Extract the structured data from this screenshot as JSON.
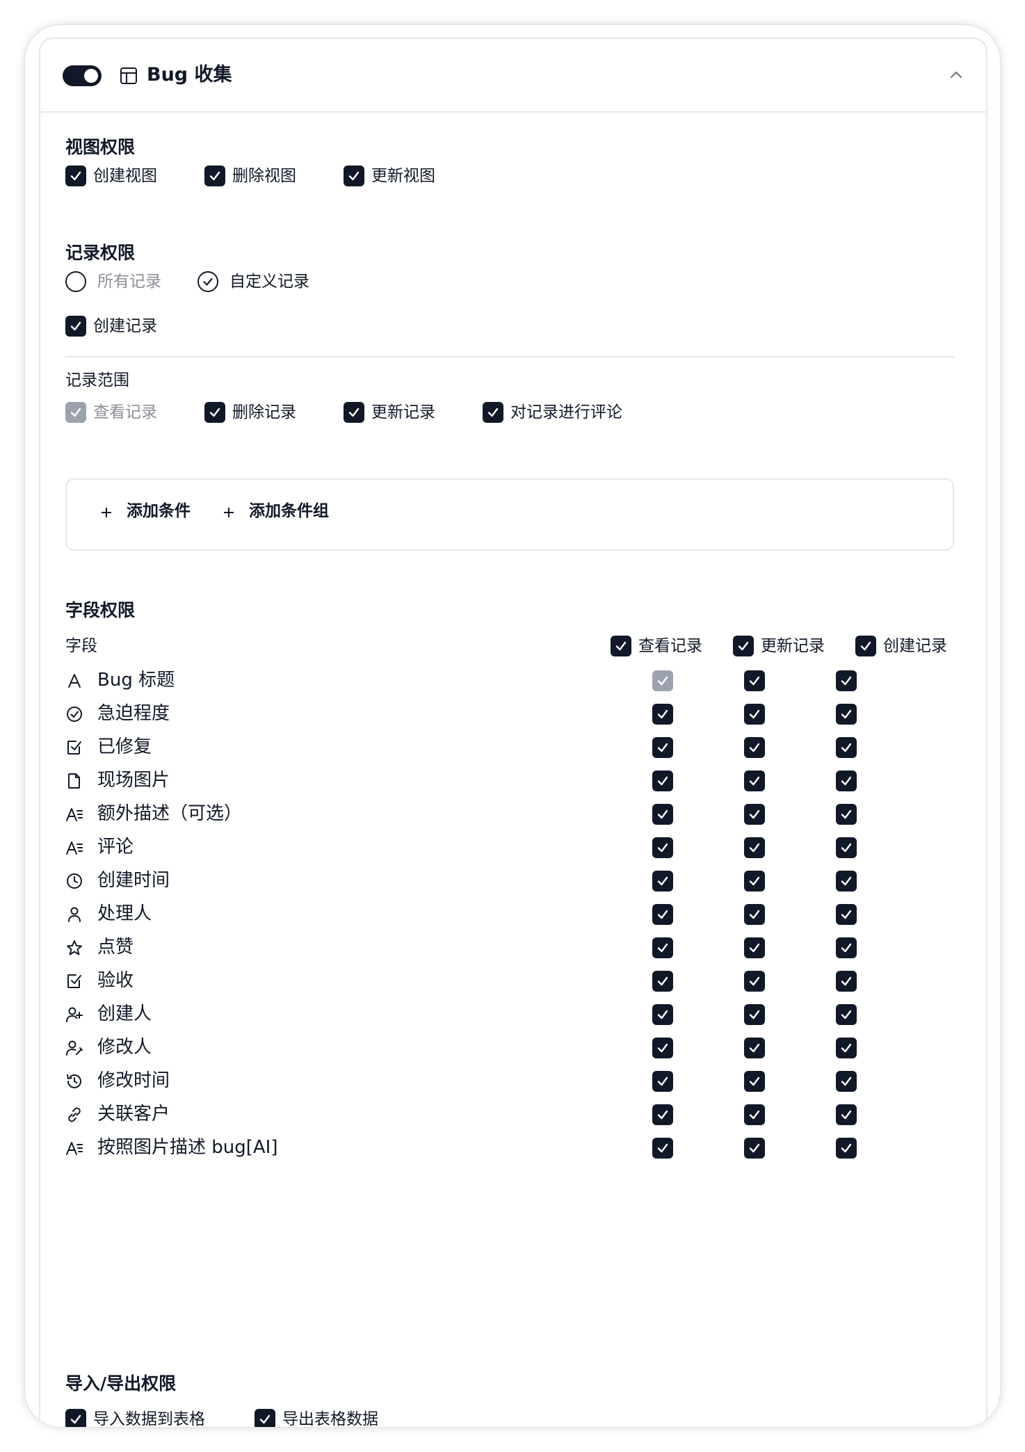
{
  "header": {
    "title": "Bug 收集"
  },
  "view_perms": {
    "title": "视图权限",
    "items": [
      {
        "label": "创建视图"
      },
      {
        "label": "删除视图"
      },
      {
        "label": "更新视图"
      }
    ]
  },
  "record_perms": {
    "title": "记录权限",
    "radio_all": "所有记录",
    "radio_custom": "自定义记录",
    "create_record": "创建记录",
    "scope_title": "记录范围",
    "scope_items": [
      {
        "label": "查看记录"
      },
      {
        "label": "删除记录"
      },
      {
        "label": "更新记录"
      },
      {
        "label": "对记录进行评论"
      }
    ],
    "add_condition": "添加条件",
    "add_condition_group": "添加条件组"
  },
  "field_perms": {
    "title": "字段权限",
    "field_header": "字段",
    "columns": [
      "查看记录",
      "更新记录",
      "创建记录"
    ],
    "rows": [
      {
        "label": "Bug 标题",
        "icon": "text-icon"
      },
      {
        "label": "急迫程度",
        "icon": "circle-check-icon"
      },
      {
        "label": "已修复",
        "icon": "checkbox-icon"
      },
      {
        "label": "现场图片",
        "icon": "file-icon"
      },
      {
        "label": "额外描述（可选）",
        "icon": "long-text-icon"
      },
      {
        "label": "评论",
        "icon": "long-text-icon"
      },
      {
        "label": "创建时间",
        "icon": "clock-icon"
      },
      {
        "label": "处理人",
        "icon": "user-icon"
      },
      {
        "label": "点赞",
        "icon": "star-icon"
      },
      {
        "label": "验收",
        "icon": "checkbox-icon"
      },
      {
        "label": "创建人",
        "icon": "user-plus-icon"
      },
      {
        "label": "修改人",
        "icon": "user-edit-icon"
      },
      {
        "label": "修改时间",
        "icon": "history-icon"
      },
      {
        "label": "关联客户",
        "icon": "link-icon"
      },
      {
        "label": "按照图片描述 bug[AI]",
        "icon": "long-text-icon"
      }
    ]
  },
  "import_export": {
    "title": "导入/导出权限",
    "items": [
      {
        "label": "导入数据到表格"
      },
      {
        "label": "导出表格数据"
      }
    ]
  }
}
